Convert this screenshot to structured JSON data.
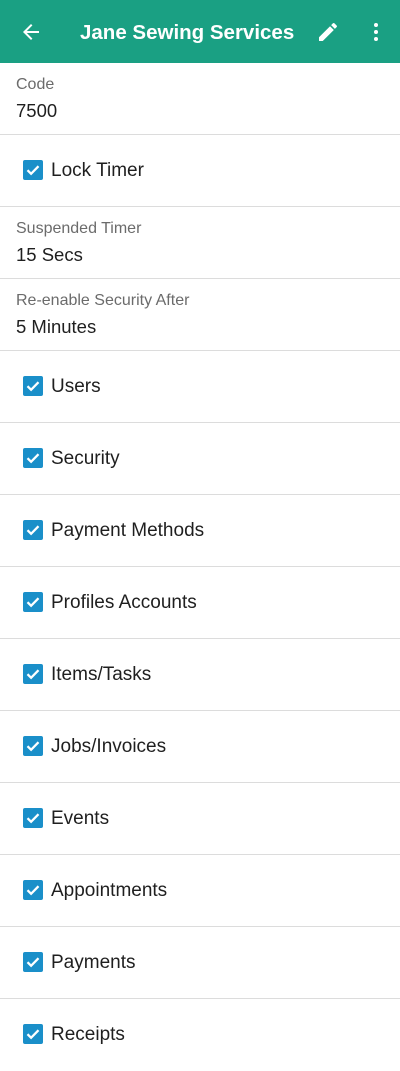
{
  "app_bar": {
    "title": "Jane Sewing Services",
    "back_icon": "arrow-back-icon",
    "edit_icon": "pencil-edit-icon",
    "more_icon": "more-vert-icon",
    "color": "#1aa083"
  },
  "code": {
    "label": "Code",
    "value": "7500"
  },
  "lock_timer": {
    "label": "Lock Timer",
    "checked": true
  },
  "suspended_timer": {
    "label": "Suspended Timer",
    "value": "15 Secs"
  },
  "reenable_security": {
    "label": "Re-enable Security After",
    "value": "5 Minutes"
  },
  "permissions": [
    {
      "label": "Users",
      "checked": true
    },
    {
      "label": "Security",
      "checked": true
    },
    {
      "label": "Payment Methods",
      "checked": true
    },
    {
      "label": "Profiles Accounts",
      "checked": true
    },
    {
      "label": "Items/Tasks",
      "checked": true
    },
    {
      "label": "Jobs/Invoices",
      "checked": true
    },
    {
      "label": "Events",
      "checked": true
    },
    {
      "label": "Appointments",
      "checked": true
    },
    {
      "label": "Payments",
      "checked": true
    },
    {
      "label": "Receipts",
      "checked": true
    }
  ],
  "checkbox_color": "#1a8fc9"
}
